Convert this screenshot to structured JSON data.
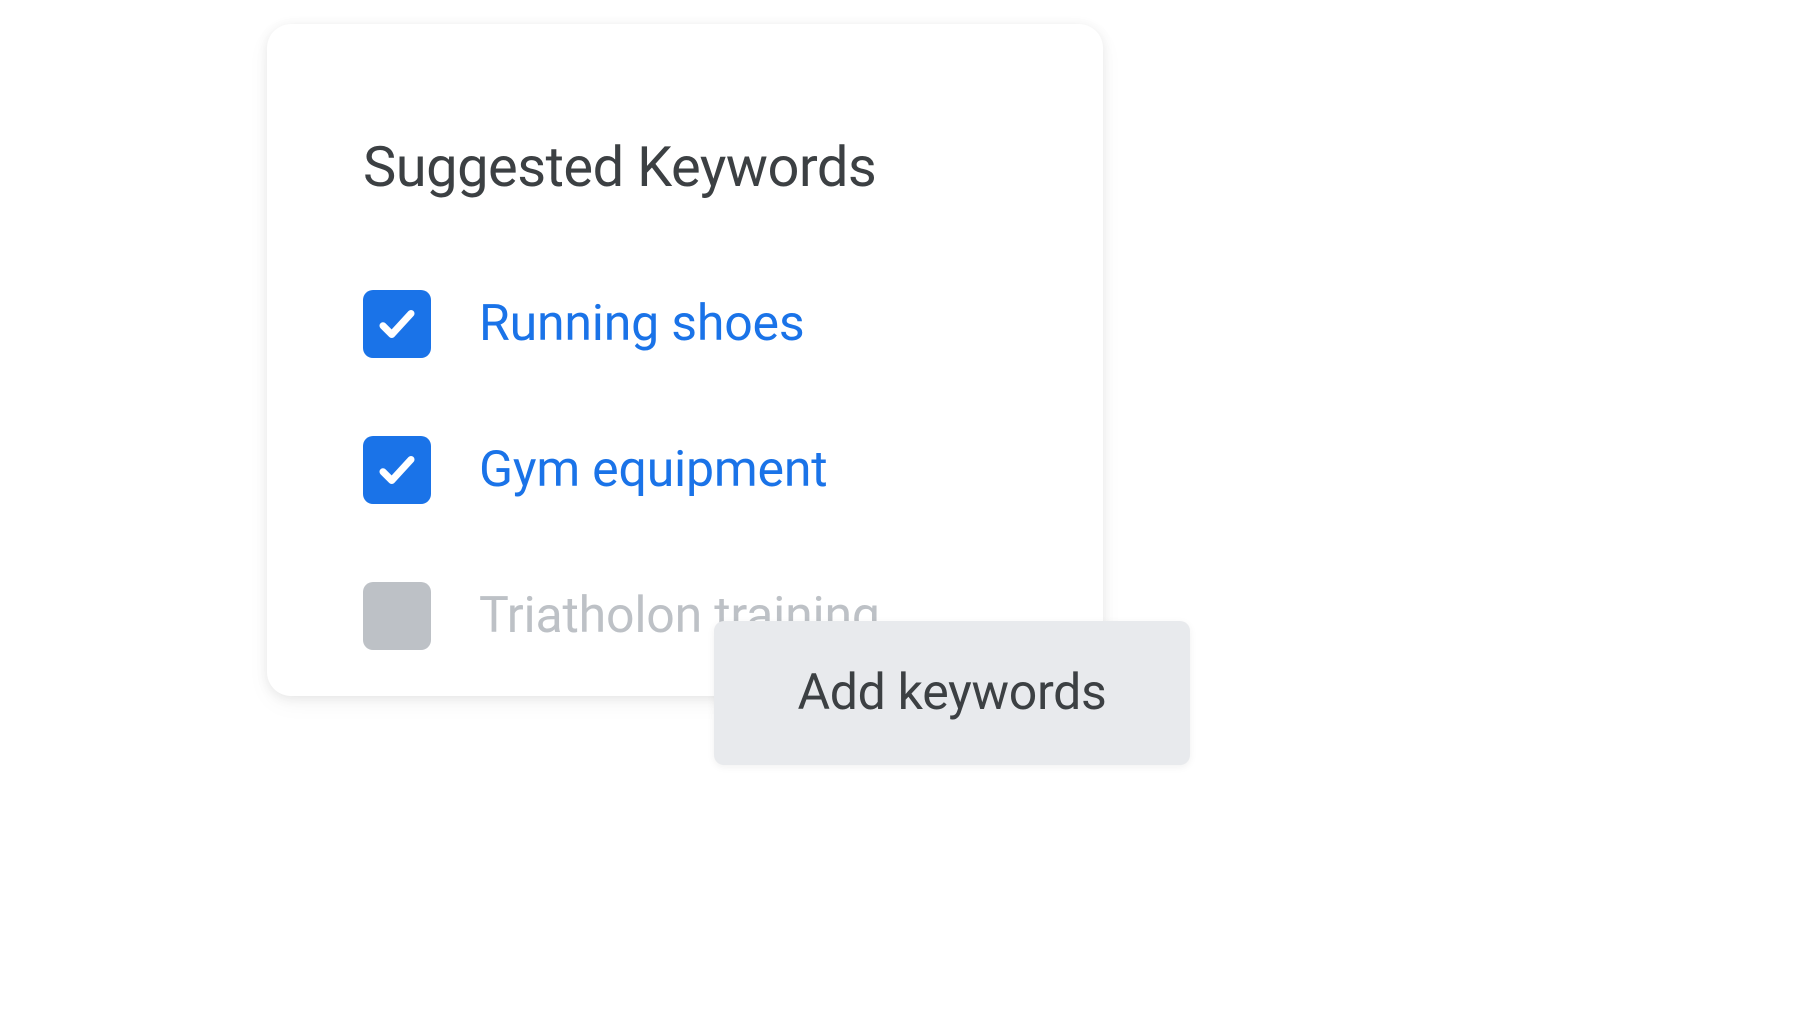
{
  "card": {
    "title": "Suggested Keywords",
    "keywords": [
      {
        "label": "Running shoes",
        "checked": true
      },
      {
        "label": "Gym equipment",
        "checked": true
      },
      {
        "label": "Triatholon training",
        "checked": false
      }
    ]
  },
  "button": {
    "add_label": "Add keywords"
  }
}
